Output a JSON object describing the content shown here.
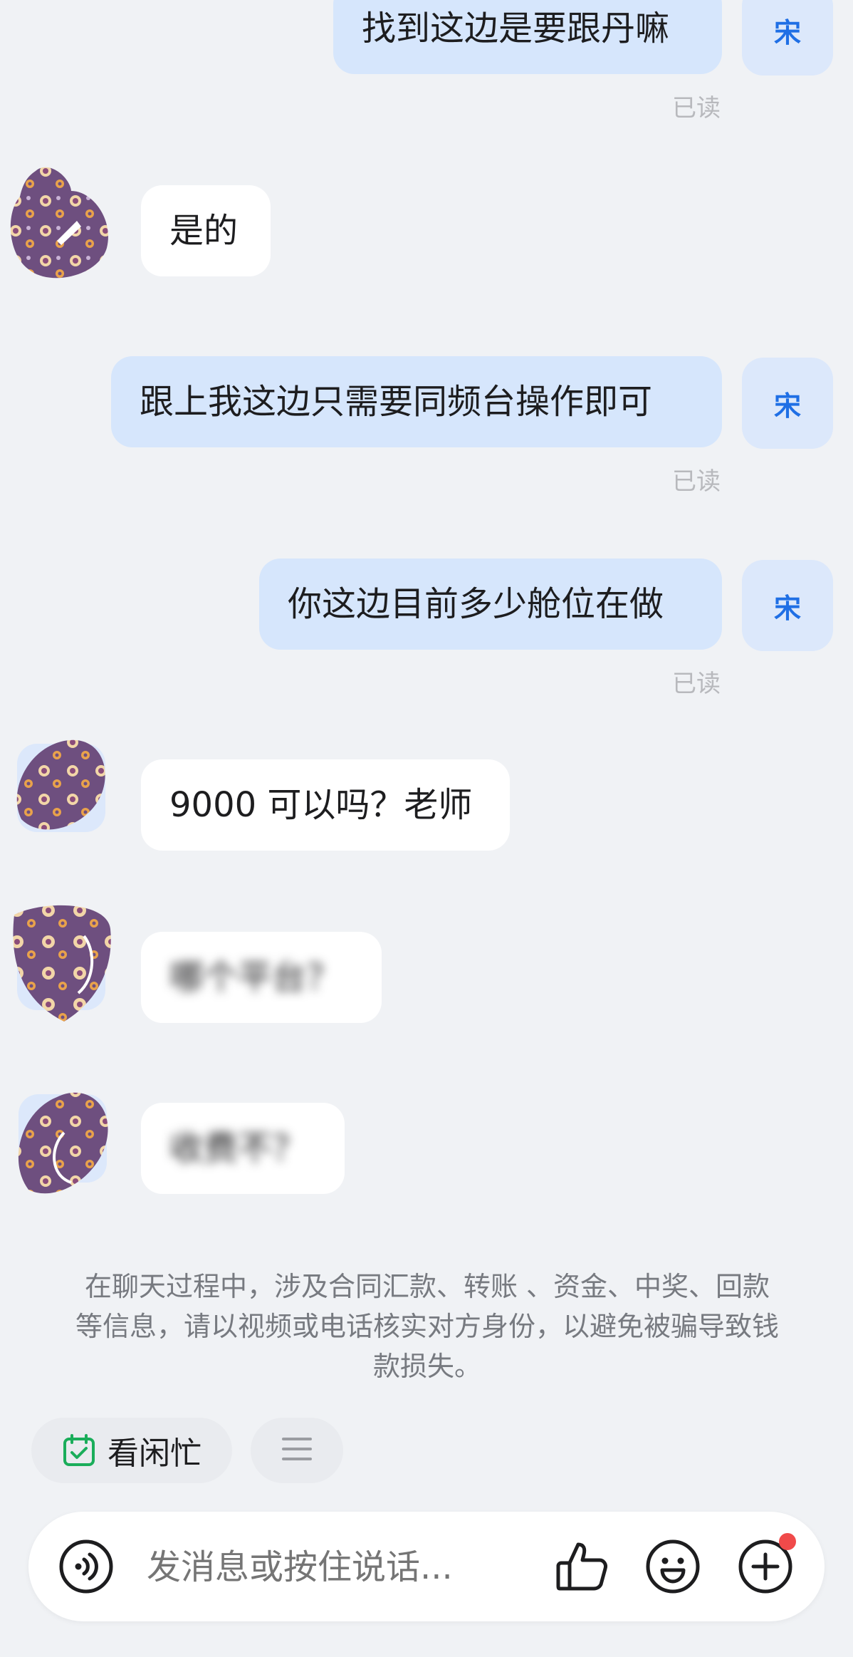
{
  "me": {
    "avatar_char": "宋"
  },
  "messages": [
    {
      "side": "out",
      "text": "找到这边是要跟丹嘛",
      "status": "已读"
    },
    {
      "side": "in",
      "text": "是的"
    },
    {
      "side": "out",
      "text": "跟上我这边只需要同频台操作即可",
      "status": "已读"
    },
    {
      "side": "out",
      "text": "你这边目前多少舱位在做",
      "status": "已读"
    },
    {
      "side": "in",
      "text": "9000 可以吗？老师"
    },
    {
      "side": "in",
      "text": "哪个平台？",
      "blurred": true
    },
    {
      "side": "in",
      "text": "收费不？",
      "blurred": true
    }
  ],
  "notice": "在聊天过程中，涉及合同汇款、转账 、资金、中奖、回款等信息，请以视频或电话核实对方身份，以避免被骗导致钱款损失。",
  "chips": {
    "schedule_label": "看闲忙",
    "schedule_icon": "calendar-check-icon",
    "menu_icon": "menu-icon"
  },
  "input": {
    "placeholder": "发消息或按住说话...",
    "icons": [
      "voice-icon",
      "thumbs-up-icon",
      "emoji-icon",
      "plus-icon"
    ],
    "plus_badge": true
  },
  "colors": {
    "background": "#f0f2f5",
    "outgoing_bubble": "#d6e6fc",
    "incoming_bubble": "#ffffff",
    "accent": "#1f6fe5",
    "badge": "#f04a4a",
    "calendar_icon": "#1aad5a"
  }
}
